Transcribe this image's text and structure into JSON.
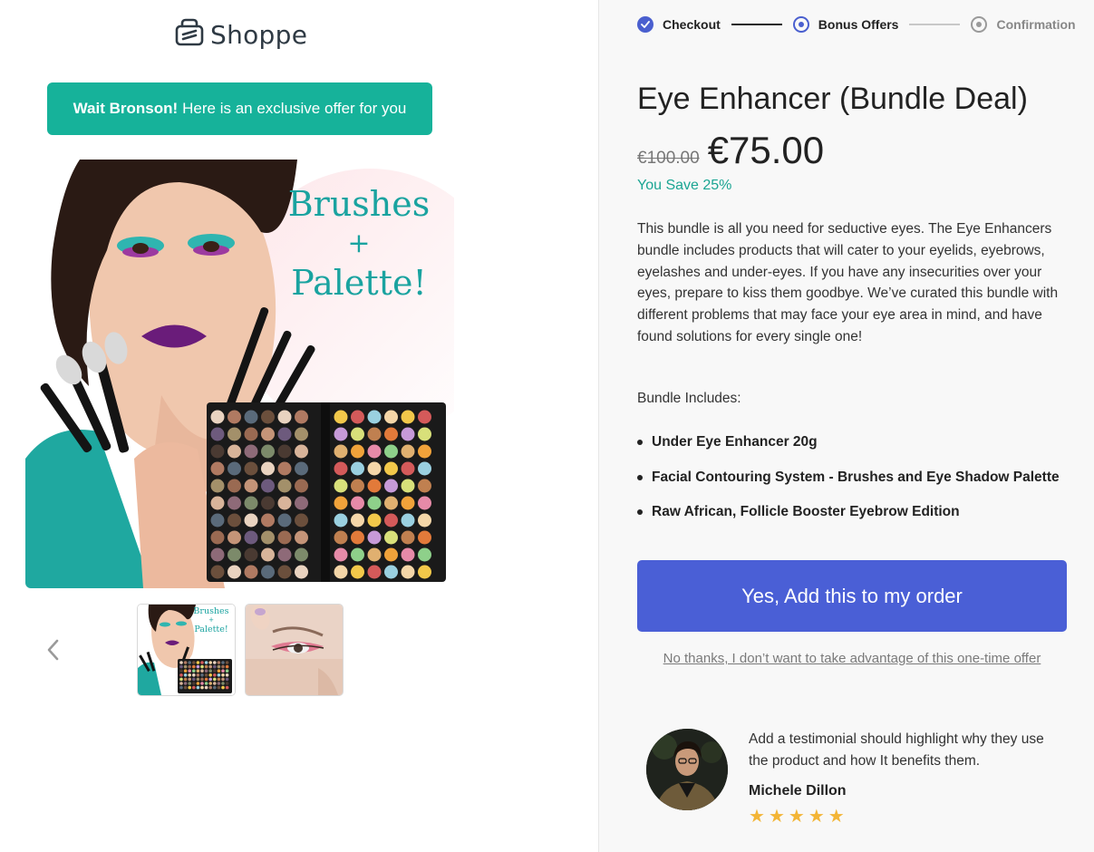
{
  "brand": {
    "name": "Shoppe"
  },
  "banner": {
    "bold": "Wait Bronson!",
    "text": "Here is an exclusive offer for you"
  },
  "hero": {
    "line1": "Brushes",
    "plus": "+",
    "line2": "Palette!"
  },
  "thumb1": {
    "line1": "Brushes",
    "plus": "+",
    "line2": "Palette!"
  },
  "steps": [
    {
      "label": "Checkout",
      "state": "complete"
    },
    {
      "label": "Bonus Offers",
      "state": "current"
    },
    {
      "label": "Confirmation",
      "state": "upcoming"
    }
  ],
  "product": {
    "title": "Eye Enhancer (Bundle Deal)",
    "old_price": "€100.00",
    "new_price": "€75.00",
    "savings": "You Save 25%",
    "description": "This bundle is all you need for seductive eyes. The Eye Enhancers bundle includes products that will cater to your eyelids, eyebrows, eyelashes and under-eyes. If you have any insecurities over your eyes, prepare to kiss them goodbye. We’ve curated this bundle with different problems that may face your eye area in mind, and have found solutions for every single one!",
    "includes_label": "Bundle Includes:",
    "includes": [
      "Under Eye Enhancer 20g",
      "Facial Contouring System - Brushes and Eye Shadow Palette",
      "Raw African, Follicle Booster Eyebrow Edition"
    ]
  },
  "actions": {
    "accept_label": "Yes, Add this to my order",
    "decline_label": "No thanks, I don’t want to take advantage of this one-time offer"
  },
  "testimonial": {
    "text": "Add a testimonial should highlight why they use the product and how It benefits them.",
    "name": "Michele Dillon",
    "rating": 5
  },
  "colors": {
    "accent": "#4a5fd6",
    "banner": "#16b29a",
    "savings": "#1ba593",
    "stars": "#f3b536"
  }
}
